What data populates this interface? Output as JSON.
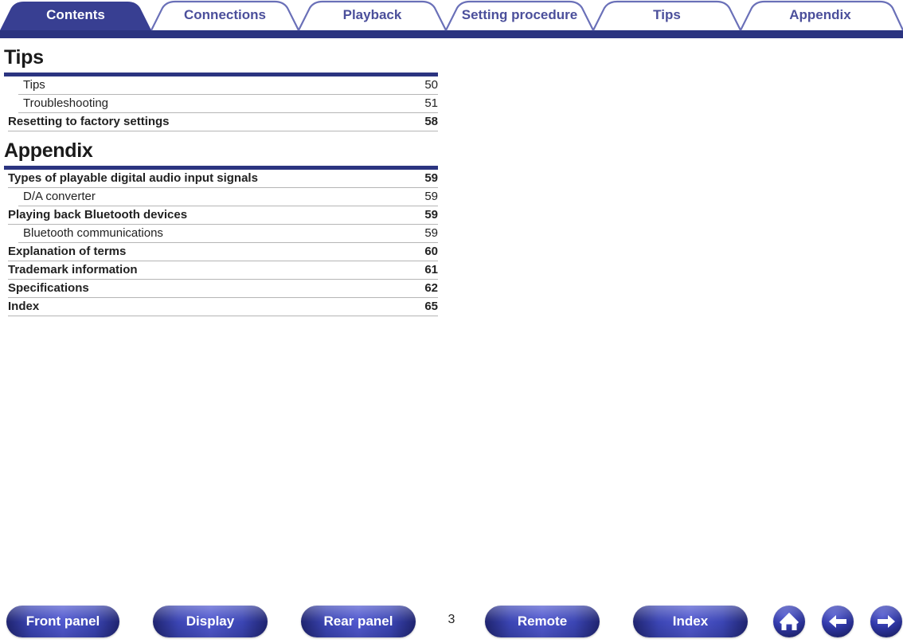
{
  "tabs": [
    {
      "label": "Contents",
      "active": true
    },
    {
      "label": "Connections",
      "active": false
    },
    {
      "label": "Playback",
      "active": false
    },
    {
      "label": "Setting procedure",
      "active": false
    },
    {
      "label": "Tips",
      "active": false
    },
    {
      "label": "Appendix",
      "active": false
    }
  ],
  "sections": [
    {
      "title": "Tips",
      "rows": [
        {
          "text": "Tips",
          "page": "50",
          "level": 2
        },
        {
          "text": "Troubleshooting",
          "page": "51",
          "level": 2
        },
        {
          "text": "Resetting to factory settings",
          "page": "58",
          "level": 1
        }
      ]
    },
    {
      "title": "Appendix",
      "rows": [
        {
          "text": "Types of playable digital audio input signals",
          "page": "59",
          "level": 1
        },
        {
          "text": "D/A converter",
          "page": "59",
          "level": 2
        },
        {
          "text": "Playing back Bluetooth devices",
          "page": "59",
          "level": 1
        },
        {
          "text": "Bluetooth communications",
          "page": "59",
          "level": 2
        },
        {
          "text": "Explanation of terms",
          "page": "60",
          "level": 1
        },
        {
          "text": "Trademark information",
          "page": "61",
          "level": 1
        },
        {
          "text": "Specifications",
          "page": "62",
          "level": 1
        },
        {
          "text": "Index",
          "page": "65",
          "level": 1
        }
      ]
    }
  ],
  "footer": {
    "buttons": [
      {
        "label": "Front panel",
        "icon": ""
      },
      {
        "label": "Display",
        "icon": ""
      },
      {
        "label": "Rear panel",
        "icon": ""
      },
      {
        "label": "Remote",
        "icon": ""
      },
      {
        "label": "Index",
        "icon": ""
      }
    ],
    "icon_buttons": [
      {
        "icon": "home-icon"
      },
      {
        "icon": "arrow-left-icon"
      },
      {
        "icon": "arrow-right-icon"
      }
    ],
    "page_number": "3"
  },
  "colors": {
    "brand_dark_blue": "#2b3480",
    "tab_active_bg": "#383f92",
    "tab_inactive_text": "#4b4f9b",
    "rule_gray": "#b5b5b5",
    "text": "#222222"
  }
}
